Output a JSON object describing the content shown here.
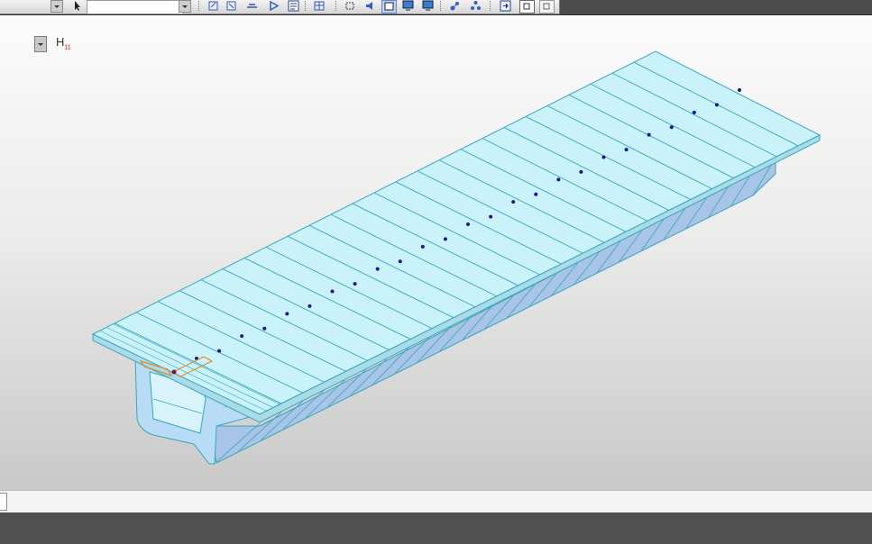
{
  "toolbar": {
    "combo_value": "",
    "buttons": [
      "select-arrow-icon",
      "copy-icon",
      "paste-icon",
      "line-icon",
      "run-icon",
      "report-icon",
      "grid-icon",
      "frame-icon",
      "audio-icon",
      "view-icon",
      "monitor-icon",
      "monitor-alt-icon",
      "node-icon",
      "link-icon",
      "import-icon",
      "save-icon",
      "info-icon"
    ]
  },
  "viewport": {
    "view_label": "H",
    "view_label_sub": "11"
  },
  "tabs": [
    {
      "label": ""
    }
  ],
  "colors": {
    "deck_top": "#c9f2fb",
    "deck_edge": "#3aa6b8",
    "girder_side": "#a8c4e6",
    "node_dot": "#1a1a8c",
    "selection": "#e08a2a"
  }
}
